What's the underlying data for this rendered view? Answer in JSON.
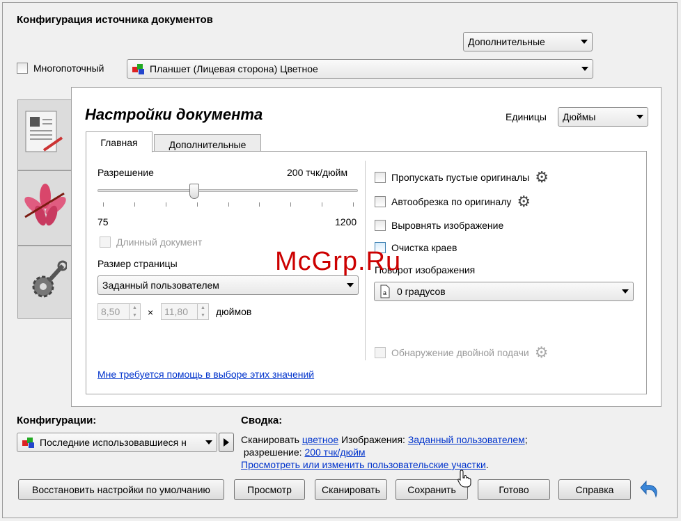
{
  "header": {
    "title": "Конфигурация источника документов"
  },
  "top": {
    "advanced_dropdown": "Дополнительные",
    "multistream_label": "Многопоточный",
    "source_dropdown": "Планшет (Лицевая сторона) Цветное"
  },
  "doc": {
    "title": "Настройки документа",
    "units_label": "Единицы",
    "units_value": "Дюймы",
    "tabs": [
      "Главная",
      "Дополнительные"
    ]
  },
  "left": {
    "resolution_label": "Разрешение",
    "resolution_value": "200 тчк/дюйм",
    "resolution_level": 200,
    "slider_min": "75",
    "slider_max": "1200",
    "long_doc_label": "Длинный документ",
    "page_size_label": "Размер страницы",
    "page_size_value": "Заданный пользователем",
    "width_value": "8,50",
    "times": "×",
    "height_value": "11,80",
    "units_text": "дюймов",
    "help_link": "Мне требуется помощь в выборе этих значений"
  },
  "right": {
    "skip_blank": "Пропускать пустые оригиналы",
    "auto_crop": "Автообрезка по оригиналу",
    "straighten": "Выровнять изображение",
    "edge_cleanup": "Очистка краев",
    "rotation_label": "Поворот изображения",
    "rotation_value": "0 градусов",
    "double_feed": "Обнаружение двойной подачи"
  },
  "bottom": {
    "configs_label": "Конфигурации:",
    "configs_value": "Последние использовавшиеся н",
    "summary_label": "Сводка:",
    "summary_scan": "Сканировать",
    "summary_color_link": "цветное",
    "summary_images": "Изображения:",
    "summary_size_link": "Заданный пользователем",
    "summary_semicolon": ";",
    "summary_resolution": "разрешение:",
    "summary_res_link": "200 тчк/дюйм",
    "summary_view_link": "Просмотреть или изменить пользовательские участки",
    "summary_dot": "."
  },
  "buttons": {
    "restore": "Восстановить настройки по умолчанию",
    "preview": "Просмотр",
    "scan": "Сканировать",
    "save": "Сохранить",
    "done": "Готово",
    "help": "Справка"
  },
  "watermark": "McGrp.Ru",
  "colors": {
    "link": "#0033cc",
    "watermark": "#cc0000"
  }
}
